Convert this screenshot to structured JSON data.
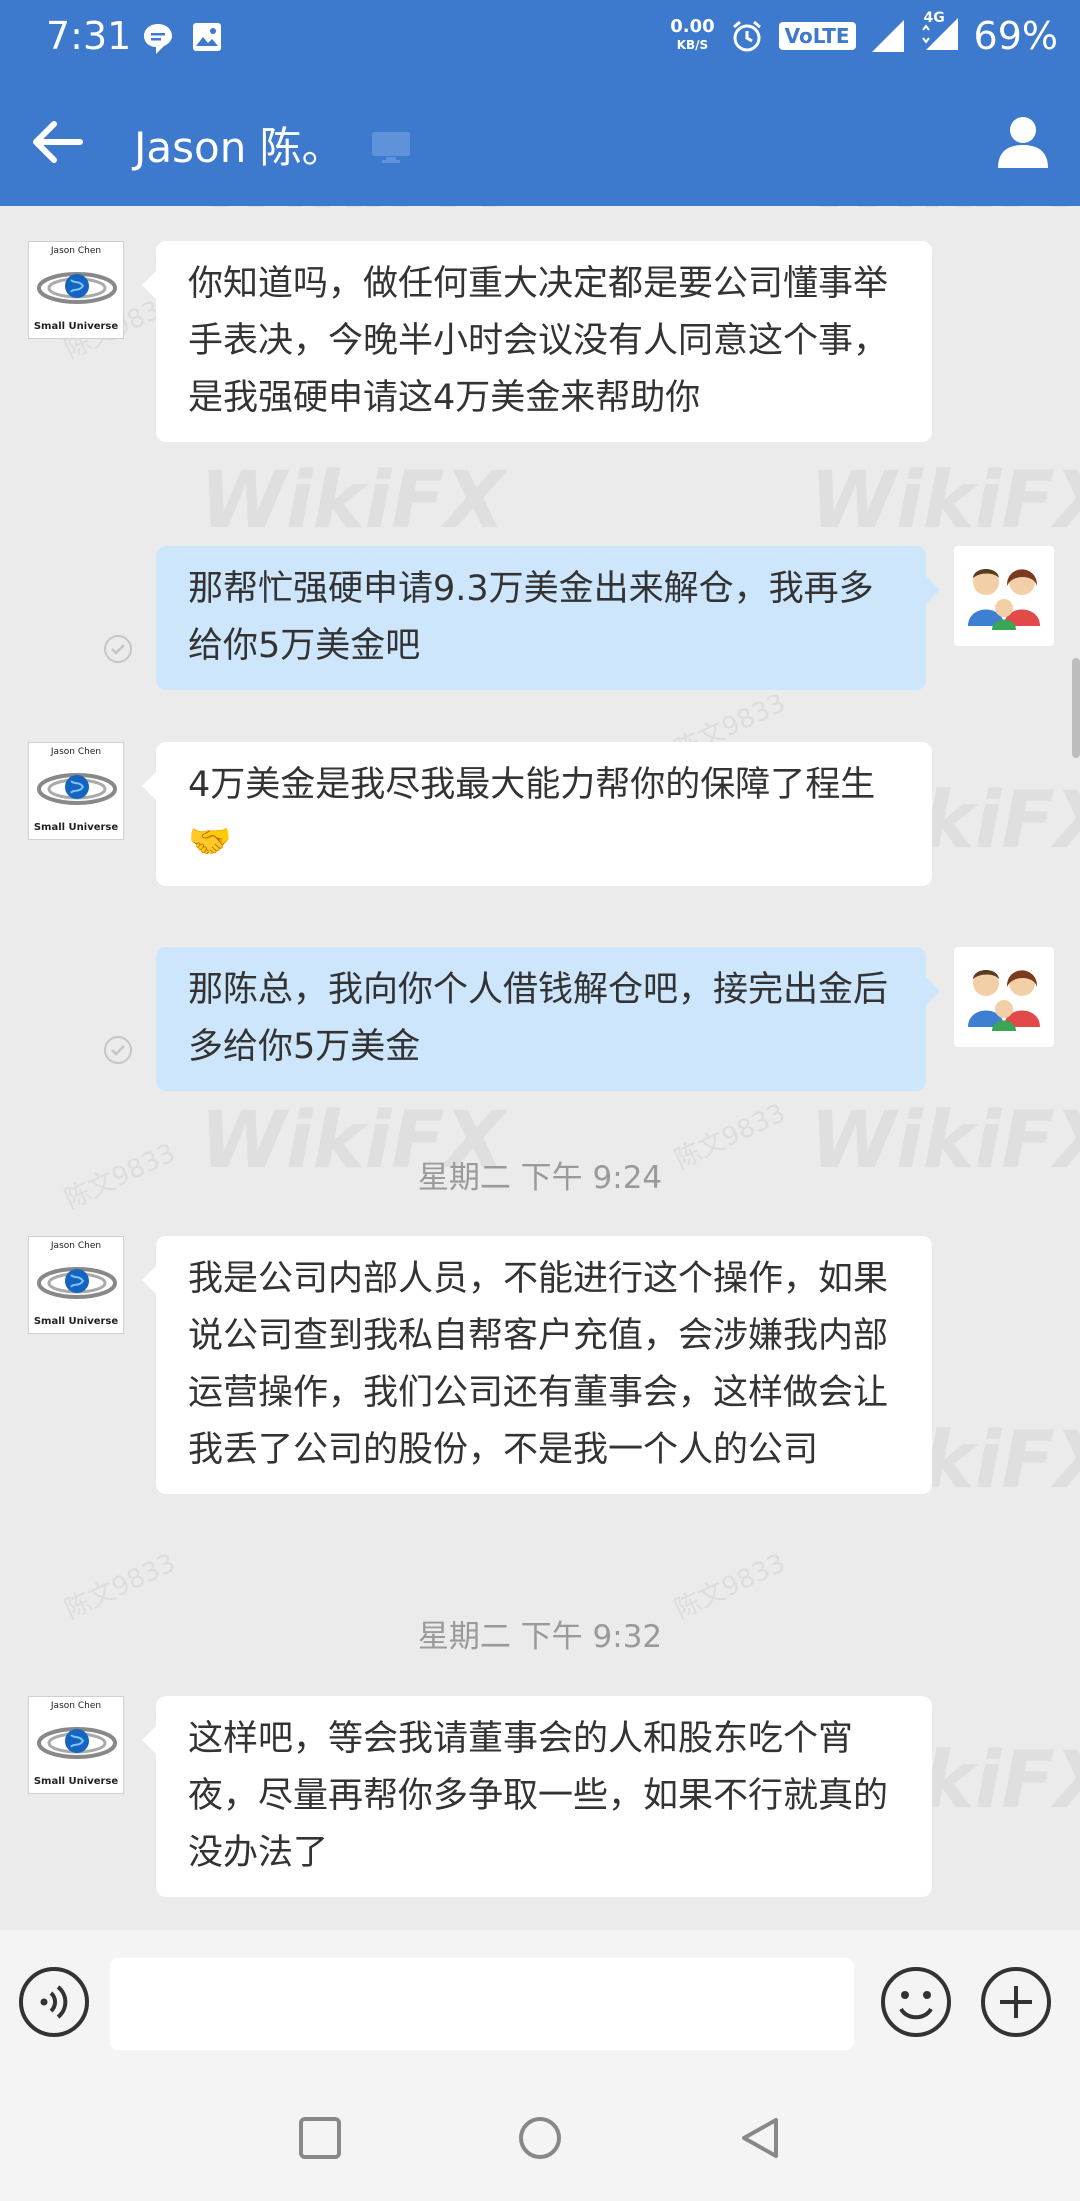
{
  "status_bar": {
    "time": "7:31",
    "net_speed_value": "0.00",
    "net_speed_unit": "KB/S",
    "volte": "VoLTE",
    "network": "4G",
    "battery": "69%"
  },
  "header": {
    "title": "Jason 陈。"
  },
  "contact_avatar": {
    "line1": "Jason Chen",
    "line2": "Small Universe"
  },
  "messages": [
    {
      "direction": "in",
      "text": "你知道吗，做任何重大决定都是要公司懂事举手表决，今晚半小时会议没有人同意这个事，是我强硬申请这4万美金来帮助你"
    },
    {
      "direction": "out",
      "text": "那帮忙强硬申请9.3万美金出来解仓，我再多给你5万美金吧"
    },
    {
      "direction": "in",
      "text": "4万美金是我尽我最大能力帮你的保障了程生🤝"
    },
    {
      "direction": "out",
      "text": "那陈总，我向你个人借钱解仓吧，接完出金后多给你5万美金"
    },
    {
      "direction": "time",
      "text": "星期二  下午 9:24"
    },
    {
      "direction": "in",
      "text": "我是公司内部人员，不能进行这个操作，如果说公司查到我私自帮客户充值，会涉嫌我内部运营操作，我们公司还有董事会，这样做会让我丢了公司的股份，不是我一个人的公司"
    },
    {
      "direction": "time",
      "text": "星期二  下午 9:32"
    },
    {
      "direction": "in",
      "text": "这样吧，等会我请董事会的人和股东吃个宵夜，尽量再帮你多争取一些，如果不行就真的没办法了"
    }
  ],
  "watermark": {
    "brand": "WikiFX",
    "sub": "陈文9833"
  },
  "input": {
    "value": "",
    "placeholder": ""
  },
  "colors": {
    "header": "#3d79cc",
    "incoming_bubble": "#ffffff",
    "outgoing_bubble": "#cde6fc",
    "chat_background": "#ebebeb"
  }
}
